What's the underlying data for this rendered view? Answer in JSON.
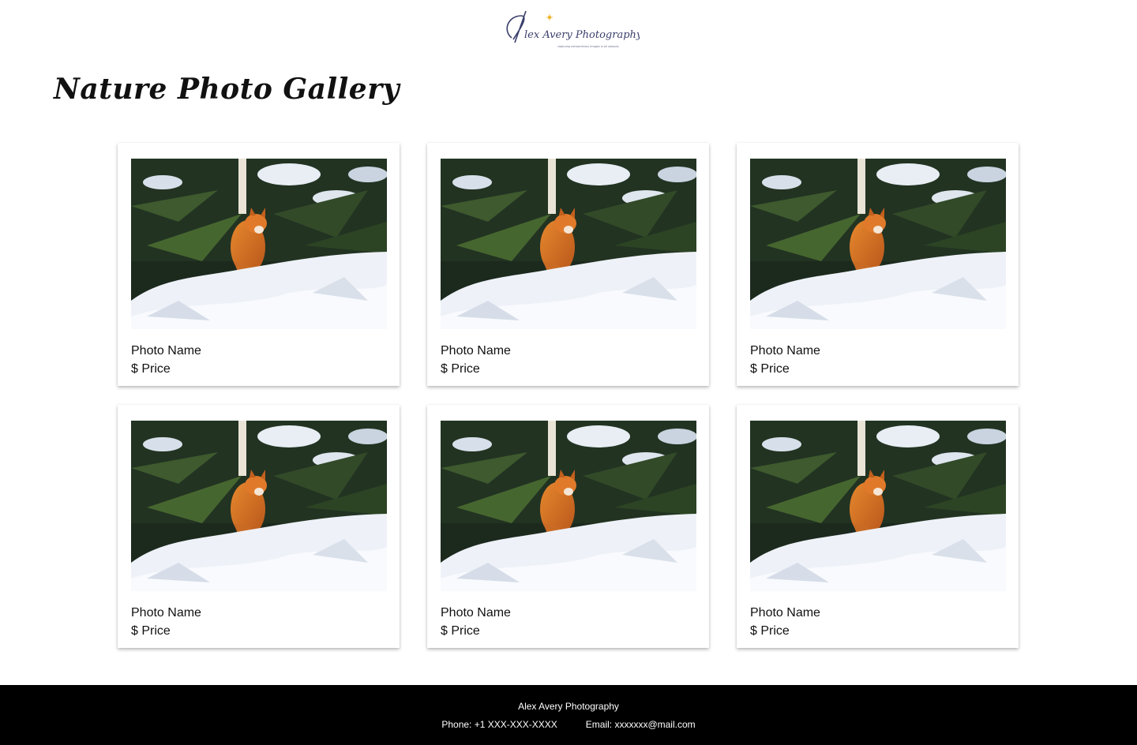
{
  "header": {
    "logo_text": "Alex Avery Photography",
    "logo_tagline": "capturing extraordinary images in all seasons"
  },
  "page": {
    "title": "Nature Photo Gallery"
  },
  "gallery": {
    "photos": [
      {
        "name": "Photo Name",
        "price": "$ Price"
      },
      {
        "name": "Photo Name",
        "price": "$ Price"
      },
      {
        "name": "Photo Name",
        "price": "$ Price"
      },
      {
        "name": "Photo Name",
        "price": "$ Price"
      },
      {
        "name": "Photo Name",
        "price": "$ Price"
      },
      {
        "name": "Photo Name",
        "price": "$ Price"
      }
    ]
  },
  "footer": {
    "brand": "Alex Avery Photography",
    "phone": "Phone: +1 XXX-XXX-XXXX",
    "email": "Email: xxxxxxx@mail.com"
  },
  "colors": {
    "background": "#ffffff",
    "footer_bg": "#000000",
    "footer_text": "#ffffff",
    "logo_accent": "#f0b429",
    "logo_ink": "#3a3f6b"
  }
}
